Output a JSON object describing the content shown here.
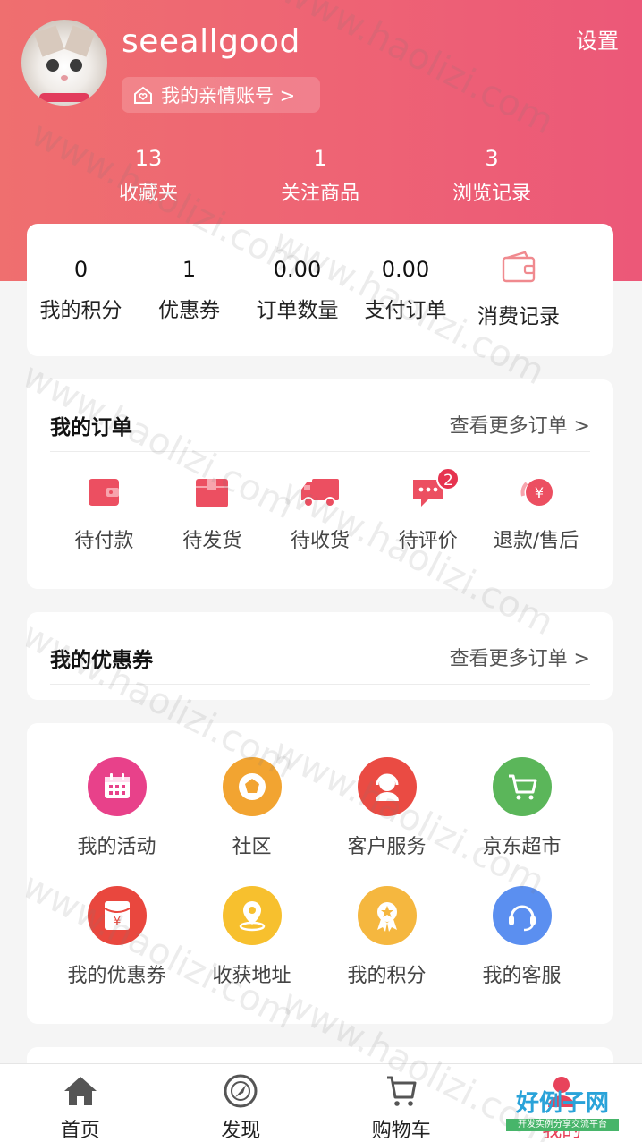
{
  "header": {
    "username": "seeallgood",
    "family_account": "我的亲情账号 >",
    "settings": "设置",
    "stats": [
      {
        "value": "13",
        "label": "收藏夹"
      },
      {
        "value": "1",
        "label": "关注商品"
      },
      {
        "value": "3",
        "label": "浏览记录"
      }
    ]
  },
  "metrics": [
    {
      "value": "0",
      "label": "我的积分"
    },
    {
      "value": "1",
      "label": "优惠券"
    },
    {
      "value": "0.00",
      "label": "订单数量"
    },
    {
      "value": "0.00",
      "label": "支付订单"
    }
  ],
  "spending": {
    "label": "消费记录",
    "icon": "wallet-icon"
  },
  "orders": {
    "title": "我的订单",
    "more": "查看更多订单 >",
    "items": [
      {
        "label": "待付款",
        "icon": "wallet-icon"
      },
      {
        "label": "待发货",
        "icon": "package-icon"
      },
      {
        "label": "待收货",
        "icon": "truck-icon"
      },
      {
        "label": "待评价",
        "icon": "comment-icon",
        "badge": "2"
      },
      {
        "label": "退款/售后",
        "icon": "refund-icon"
      }
    ]
  },
  "coupons": {
    "title": "我的优惠券",
    "more": "查看更多订单 >"
  },
  "services": [
    {
      "label": "我的活动",
      "icon": "calendar-icon",
      "color": "#e8418a"
    },
    {
      "label": "社区",
      "icon": "community-icon",
      "color": "#f2a431"
    },
    {
      "label": "客户服务",
      "icon": "customer-service-icon",
      "color": "#ea4b43"
    },
    {
      "label": "京东超市",
      "icon": "cart-icon",
      "color": "#5bb65a"
    },
    {
      "label": "我的优惠券",
      "icon": "coupon-icon",
      "color": "#e9473e"
    },
    {
      "label": "收获地址",
      "icon": "location-icon",
      "color": "#f7c02e"
    },
    {
      "label": "我的积分",
      "icon": "medal-icon",
      "color": "#f5b73f"
    },
    {
      "label": "我的客服",
      "icon": "headset-icon",
      "color": "#5b8ff0"
    }
  ],
  "tabbar": [
    {
      "label": "首页",
      "icon": "home-icon"
    },
    {
      "label": "发现",
      "icon": "compass-icon"
    },
    {
      "label": "购物车",
      "icon": "cart-icon"
    },
    {
      "label": "我的",
      "icon": "user-icon"
    }
  ],
  "watermark": {
    "text": "www.haolizi.com"
  },
  "logo": {
    "title": "好例子网",
    "subtitle": "开发实例分享交流平台"
  },
  "colors": {
    "accent": "#e8435b",
    "header_start": "#ef6f6f",
    "header_end": "#ec5878"
  }
}
